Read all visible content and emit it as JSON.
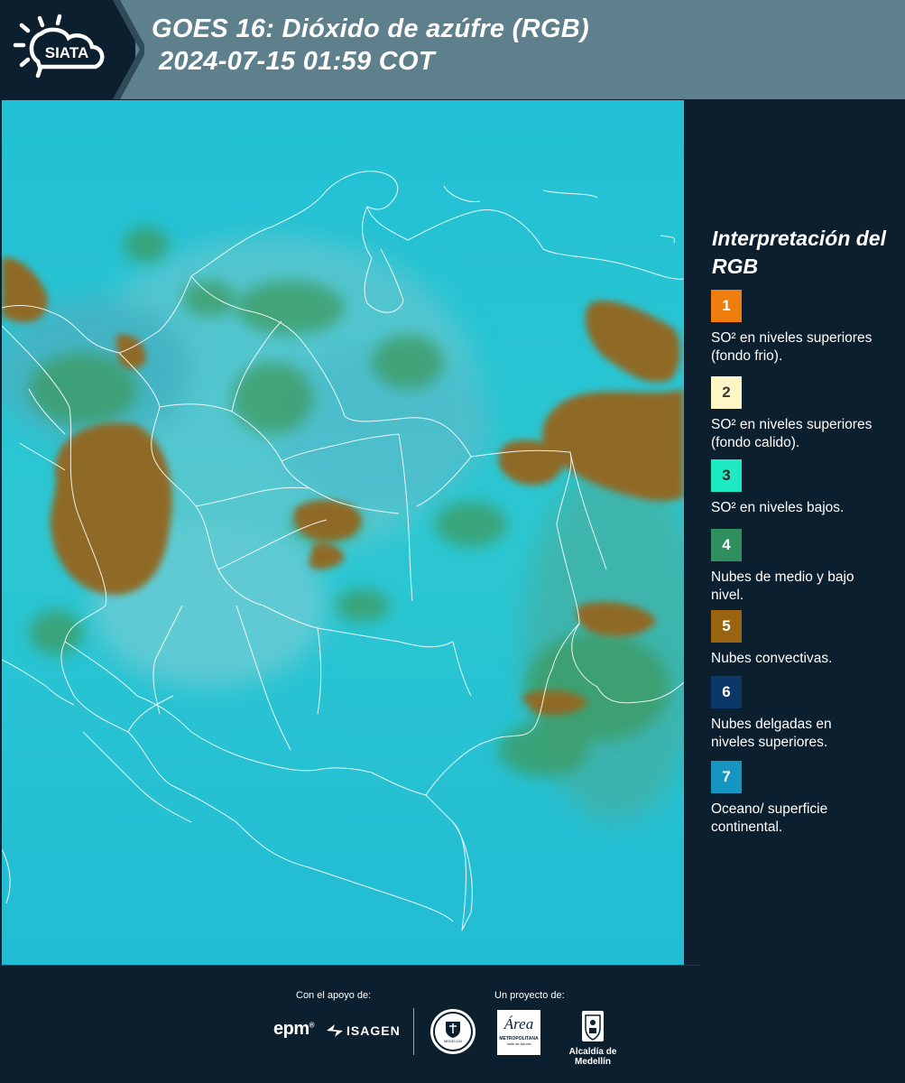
{
  "header": {
    "logo_text": "SIATA",
    "title_line1": "GOES 16: Dióxido de azúfre (RGB)",
    "title_line2": "2024-07-15 01:59 COT"
  },
  "legend": {
    "title": "Interpretación del RGB",
    "items": [
      {
        "number": "1",
        "label": "SO² en niveles superiores (fondo frio).",
        "color": "#f07e0e",
        "text_color": "#ffffff"
      },
      {
        "number": "2",
        "label": "SO² en niveles superiores (fondo calido).",
        "color": "#fff6c5",
        "text_color": "#3a3a3a"
      },
      {
        "number": "3",
        "label": "SO² en niveles bajos.",
        "color": "#1de9c3",
        "text_color": "#2a2a2a"
      },
      {
        "number": "4",
        "label": "Nubes de medio y bajo nivel.",
        "color": "#2f8f5e",
        "text_color": "#ffffff"
      },
      {
        "number": "5",
        "label": "Nubes convectivas.",
        "color": "#9a6410",
        "text_color": "#ffffff"
      },
      {
        "number": "6",
        "label": "Nubes delgadas en niveles superiores.",
        "color": "#0c3869",
        "text_color": "#ffffff"
      },
      {
        "number": "7",
        "label": "Oceano/ superficie continental.",
        "color": "#1595bf",
        "text_color": "#ffffff"
      }
    ]
  },
  "map": {
    "colors": {
      "ocean": "#27c3d3",
      "convective": "#8a6a2a",
      "midlevel": "#3a9a66",
      "thin_high": "#6fb3c0",
      "borders": "#ffffff"
    }
  },
  "footer": {
    "support_label": "Con el apoyo de:",
    "project_label": "Un proyecto de:",
    "epm_logo": "epm",
    "isagen_logo": "ISAGEN",
    "medellin_seal": "MEDELLIN",
    "area_logo": "Área",
    "area_subtitle": "METROPOLITANA",
    "area_subtitle2": "Valle de Aburrá",
    "alcaldia_logo": "Alcaldía de Medellín"
  }
}
